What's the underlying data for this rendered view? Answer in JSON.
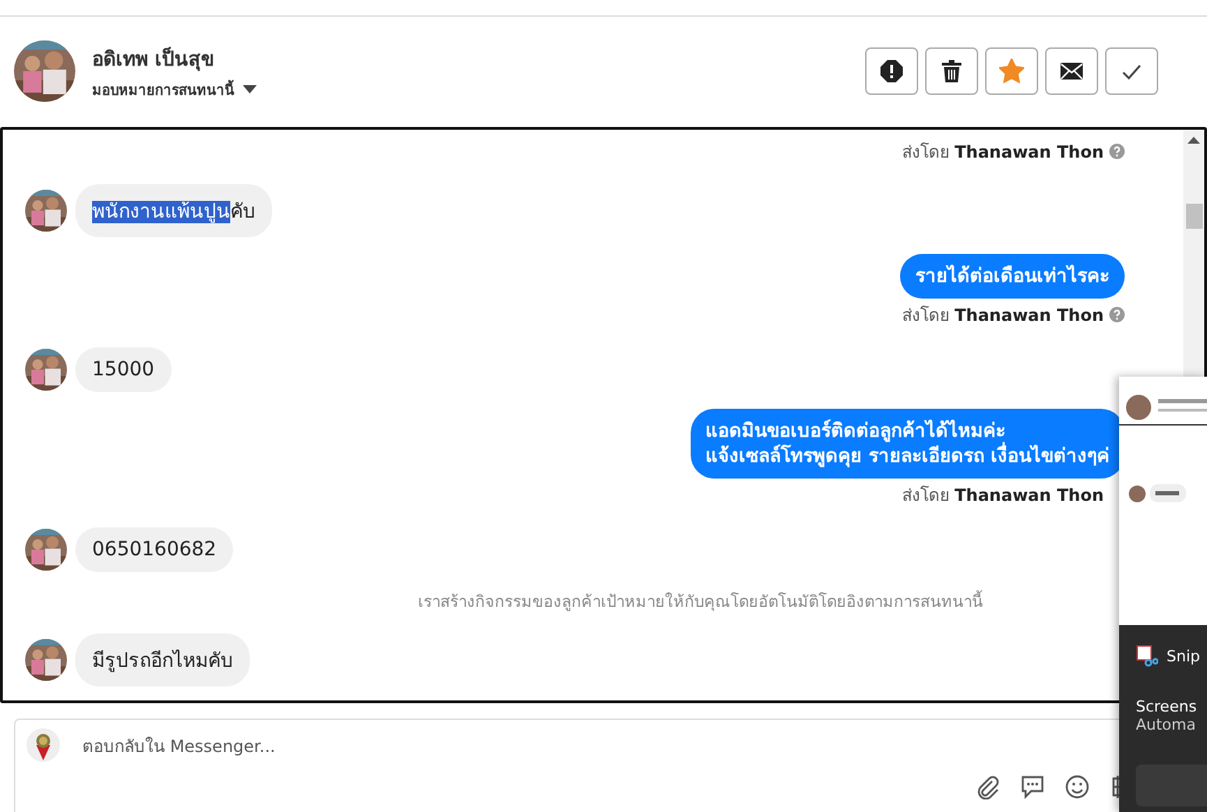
{
  "contact": {
    "name": "อดิเทพ เป็นสุข",
    "assign_label": "มอบหมายการสนทนานี้"
  },
  "actions": [
    {
      "kind": "alert"
    },
    {
      "kind": "delete"
    },
    {
      "kind": "star",
      "on": true
    },
    {
      "kind": "mail"
    },
    {
      "kind": "done"
    }
  ],
  "messages": [
    {
      "kind": "sent_by",
      "prefix": "ส่งโดย",
      "name": "Thanawan Thon",
      "help_icon": true
    },
    {
      "kind": "incoming",
      "parts": [
        {
          "text": "พนักงานแพ้นปูน",
          "selected": true
        },
        {
          "text": "คับ",
          "selected": false
        }
      ]
    },
    {
      "kind": "outgoing",
      "lines": [
        "รายได้ต่อเดือนเท่าไรคะ"
      ]
    },
    {
      "kind": "sent_by",
      "prefix": "ส่งโดย",
      "name": "Thanawan Thon",
      "help_icon": true
    },
    {
      "kind": "incoming",
      "parts": [
        {
          "text": "15000",
          "selected": false
        }
      ]
    },
    {
      "kind": "outgoing",
      "lines": [
        "แอดมินขอเบอร์ติดต่อลูกค้าได้ไหมค่ะ",
        "แจ้งเซลล์โทรพูดคุย รายละเอียดรถ เงื่อนไขต่างๆค่"
      ]
    },
    {
      "kind": "sent_by",
      "prefix": "ส่งโดย",
      "name": "Thanawan Thon",
      "help_icon": false
    },
    {
      "kind": "incoming",
      "parts": [
        {
          "text": "0650160682",
          "selected": false
        }
      ]
    },
    {
      "kind": "system",
      "text": "เราสร้างกิจกรรมของลูกค้าเป้าหมายให้กับคุณโดยอัตโนมัติโดยอิงตามการสนทนานี้"
    },
    {
      "kind": "incoming",
      "parts": [
        {
          "text": "มีรูปรถอีกไหมคับ",
          "selected": false
        }
      ]
    }
  ],
  "reply": {
    "placeholder": "ตอบกลับใน Messenger..."
  },
  "composer_tools": [
    {
      "kind": "attach"
    },
    {
      "kind": "chat"
    },
    {
      "kind": "emoji"
    },
    {
      "kind": "baht"
    }
  ],
  "notification": {
    "app": "Snip",
    "title": "Screens",
    "body": "Automa"
  }
}
